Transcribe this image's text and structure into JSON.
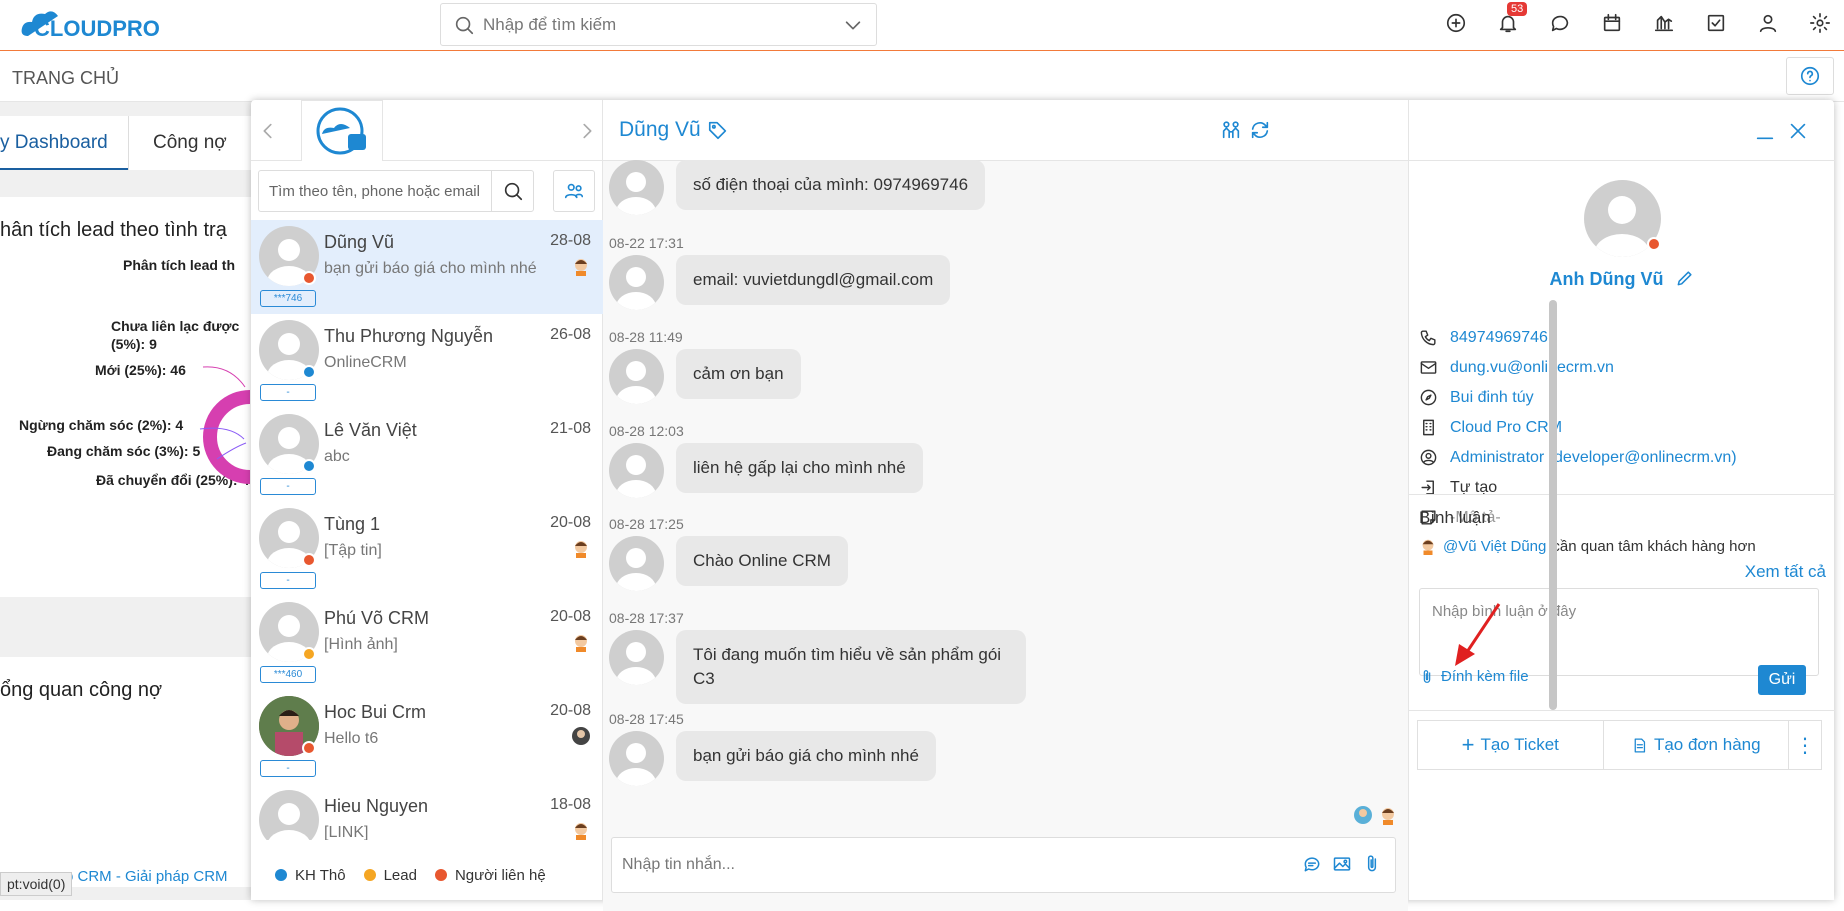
{
  "topbar": {
    "logo_text": "CLOUDPRO",
    "search_placeholder": "Nhập để tìm kiếm",
    "notification_count": "53"
  },
  "subbar": {
    "title": "TRANG CHỦ"
  },
  "dashboard": {
    "tabs": [
      "y Dashboard",
      "Công nợ"
    ],
    "card1_title": "hân tích lead theo tình trạ",
    "chart_title": "Phân tích lead th",
    "chart_labels": [
      "Chưa liên lạc được",
      "(5%): 9",
      "Mới (25%): 46",
      "Ngừng chăm sóc (2%): 4",
      "Đang chăm sóc (3%): 5",
      "Đã chuyển đổi (25%): 4"
    ],
    "card2_title": "ổng quan công nợ",
    "footer_text": "ro CRM - Giải pháp CRM",
    "status_link": "pt:void(0)"
  },
  "chat": {
    "search_placeholder": "Tìm theo tên, phone hoặc email",
    "contacts": [
      {
        "name": "Dũng Vũ",
        "date": "28-08",
        "msg": "bạn gửi báo giá cho mình nhé",
        "tag": "***746",
        "dot": "#e8572f"
      },
      {
        "name": "Thu Phương Nguyễn",
        "date": "26-08",
        "msg": "OnlineCRM",
        "tag": "-",
        "dot": "#1e88d2"
      },
      {
        "name": "Lê Văn Việt",
        "date": "21-08",
        "msg": "abc",
        "tag": "-",
        "dot": "#1e88d2"
      },
      {
        "name": "Tùng 1",
        "date": "20-08",
        "msg": "[Tập tin]",
        "tag": "-",
        "dot": "#e8572f"
      },
      {
        "name": "Phú Võ CRM",
        "date": "20-08",
        "msg": "[Hình ảnh]",
        "tag": "***460",
        "dot": "#f5a623"
      },
      {
        "name": "Hoc Bui Crm",
        "date": "20-08",
        "msg": "Hello t6",
        "tag": "-",
        "dot": "#e8572f"
      },
      {
        "name": "Hieu Nguyen",
        "date": "18-08",
        "msg": "[LINK]",
        "tag": "",
        "dot": "#e8572f"
      }
    ],
    "legend": [
      {
        "label": "KH Thô",
        "color": "#1e88d2"
      },
      {
        "label": "Lead",
        "color": "#f5a623"
      },
      {
        "label": "Người liên hệ",
        "color": "#e8572f"
      }
    ],
    "conversation": {
      "name": "Dũng Vũ",
      "messages": [
        {
          "time": "",
          "text": "số điện thoại của mình: 0974969746"
        },
        {
          "time": "08-22 17:31",
          "text": "email: vuvietdungdl@gmail.com"
        },
        {
          "time": "08-28 11:49",
          "text": "cảm ơn bạn"
        },
        {
          "time": "08-28 12:03",
          "text": "liên hệ gấp lại cho mình nhé"
        },
        {
          "time": "08-28 17:25",
          "text": "Chào Online CRM"
        },
        {
          "time": "08-28 17:37",
          "text": "Tôi đang muốn tìm hiểu về sản phẩm gói C3"
        },
        {
          "time": "08-28 17:45",
          "text": "bạn gửi báo giá cho mình nhé"
        }
      ],
      "input_placeholder": "Nhập tin nhắn..."
    },
    "profile": {
      "name": "Anh Dũng Vũ",
      "phone": "84974969746",
      "email": "dung.vu@onlinecrm.vn",
      "address": "Bui đinh túy",
      "company": "Cloud Pro CRM",
      "owner": "Administrator (developer@onlinecrm.vn)",
      "source": "Tự tạo",
      "description": "-Mô tả-",
      "comments_title": "Bình luận",
      "comment_mention": "@Vũ Việt Dũng",
      "comment_text": "cần quan tâm khách hàng hơn",
      "view_all": "Xem tất cả",
      "comment_placeholder": "Nhập bình luận ở đây",
      "attach_label": "Đính kèm file",
      "send_label": "Gửi",
      "create_ticket": "Tạo Ticket",
      "create_order": "Tạo đơn hàng"
    }
  }
}
